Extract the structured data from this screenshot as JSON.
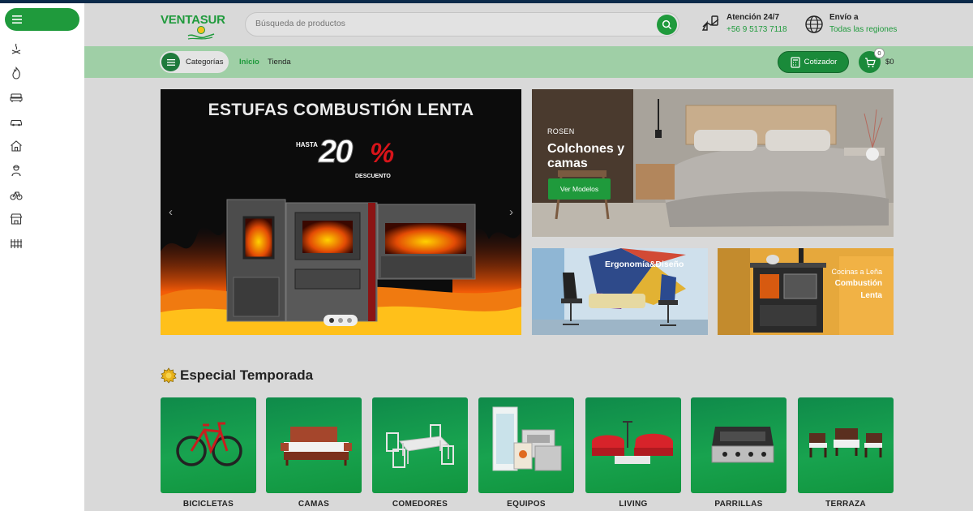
{
  "sidebar": {
    "menu_icon": "hamburger-icon",
    "icons": [
      "campfire-icon",
      "flame-icon",
      "sofa-icon",
      "car-icon",
      "house-icon",
      "worker-icon",
      "bicycle-icon",
      "storefront-icon",
      "fence-icon"
    ]
  },
  "header": {
    "logo_text": "VENTASUR",
    "search_placeholder": "Búsqueda de productos",
    "attention_title": "Atención 24/7",
    "attention_phone": "+56 9 5173 7118",
    "shipping_title": "Envío a",
    "shipping_region": "Todas las regiones"
  },
  "nav": {
    "categories_label": "Categorías",
    "links": [
      "Inicio",
      "Tienda"
    ],
    "quote_label": "Cotizador",
    "cart_count": "0",
    "cart_total": "$0"
  },
  "hero": {
    "title": "ESTUFAS COMBUSTIÓN LENTA",
    "hasta": "HASTA",
    "discount_number": "20",
    "discount_symbol": "%",
    "discount_word": "DESCUENTO",
    "slide_count": 3,
    "active_slide": 1
  },
  "banners": {
    "colchones": {
      "brand": "ROSEN",
      "title": "Colchones y camas",
      "button": "Ver Modelos"
    },
    "ergonomia": {
      "title": "Ergonomía&Diseño"
    },
    "cocinas": {
      "line1": "Cocinas a Leña",
      "line2": "Combustión",
      "line3": "Lenta"
    }
  },
  "special": {
    "title": "Especial Temporada",
    "icon": "sun-badge-icon",
    "categories": [
      "BICICLETAS",
      "CAMAS",
      "COMEDORES",
      "EQUIPOS",
      "LIVING",
      "PARRILLAS",
      "TERRAZA"
    ]
  },
  "colors": {
    "brand_green": "#1f9a3c",
    "nav_green": "#9fcfa6",
    "dark_navy": "#0b2a4a",
    "discount_red": "#d8141a"
  }
}
